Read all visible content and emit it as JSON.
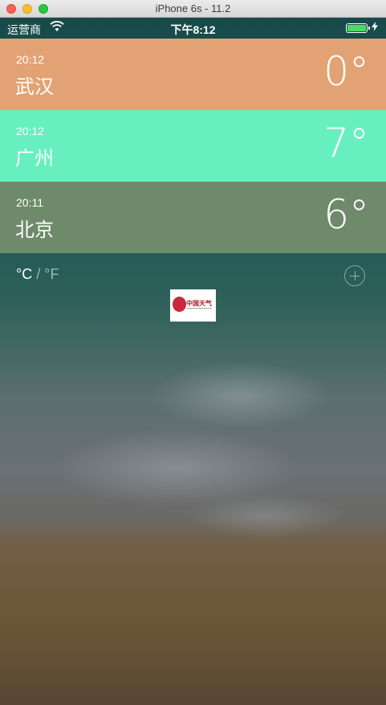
{
  "window": {
    "title": "iPhone 6s - 11.2"
  },
  "status_bar": {
    "carrier": "运营商",
    "time": "下午8:12",
    "battery_color": "#4cd964"
  },
  "cities": [
    {
      "time": "20:12",
      "name": "武汉",
      "temp": "0°",
      "color": "#e2a274"
    },
    {
      "time": "20:12",
      "name": "广州",
      "temp": "7°",
      "color": "#67efc0"
    },
    {
      "time": "20:11",
      "name": "北京",
      "temp": "6°",
      "color": "#6e8a6a"
    }
  ],
  "units": {
    "celsius": "°C",
    "separator": "/",
    "fahrenheit": "°F"
  },
  "logo": {
    "text": "中国天气"
  },
  "icons": {
    "wifi": "wifi-icon",
    "add": "plus-circle-icon",
    "charging": "bolt-icon"
  }
}
